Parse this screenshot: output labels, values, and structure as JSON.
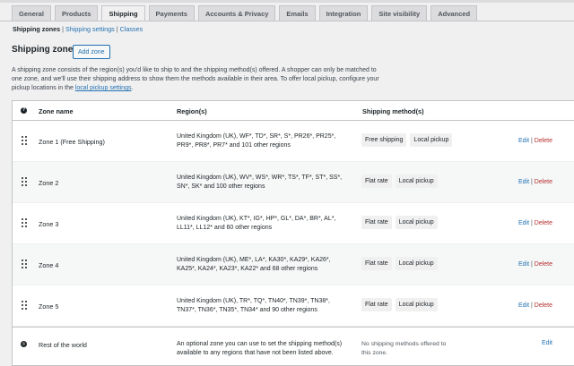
{
  "tabs": [
    "General",
    "Products",
    "Shipping",
    "Payments",
    "Accounts & Privacy",
    "Emails",
    "Integration",
    "Site visibility",
    "Advanced"
  ],
  "active_tab": 2,
  "subnav": {
    "current": "Shipping zones",
    "sep": "|",
    "links": [
      "Shipping settings",
      "Classes"
    ]
  },
  "page": {
    "title": "Shipping zones",
    "add_label": "Add zone"
  },
  "description": {
    "text": "A shipping zone consists of the region(s) you'd like to ship to and the shipping method(s) offered. A shopper can only be matched to one zone, and we'll use their shipping address to show them the methods available in their area. To offer local pickup, configure your pickup locations in the ",
    "link": "local pickup settings",
    "end": "."
  },
  "table": {
    "headers": {
      "help": "?",
      "name": "Zone name",
      "regions": "Region(s)",
      "methods": "Shipping method(s)"
    },
    "rows": [
      {
        "name": "Zone 1 (Free Shipping)",
        "regions_line1": "United Kingdom (UK), WF*, TD*, SR*, S*, PR26*, PR25*,",
        "regions_line2": "PR9*, PR8*, PR7* and 101 other regions",
        "methods": [
          "Free shipping",
          "Local pickup"
        ]
      },
      {
        "name": "Zone 2",
        "regions_line1": "United Kingdom (UK), WV*, WS*, WR*, TS*, TF*, ST*, SS*,",
        "regions_line2": "SN*, SK* and 100 other regions",
        "methods": [
          "Flat rate",
          "Local pickup"
        ]
      },
      {
        "name": "Zone 3",
        "regions_line1": "United Kingdom (UK), KT*, IG*, HP*, GL*, DA*, BR*, AL*,",
        "regions_line2": "LL11*, LL12* and 60 other regions",
        "methods": [
          "Flat rate",
          "Local pickup"
        ]
      },
      {
        "name": "Zone 4",
        "regions_line1": "United Kingdom (UK), ME*, LA*, KA30*, KA29*, KA26*,",
        "regions_line2": "KA25*, KA24*, KA23*, KA22* and 68 other regions",
        "methods": [
          "Flat rate",
          "Local pickup"
        ]
      },
      {
        "name": "Zone 5",
        "regions_line1": "United Kingdom (UK), TR*, TQ*, TN40*, TN39*, TN38*,",
        "regions_line2": "TN37*, TN36*, TN35*, TN34* and 90 other regions",
        "methods": [
          "Flat rate",
          "Local pickup"
        ]
      }
    ],
    "rest": {
      "name": "Rest of the world",
      "regions_line1": "An optional zone you can use to set the shipping method(s)",
      "regions_line2": "available to any regions that have not been listed above.",
      "methods_line1": "No shipping methods offered to",
      "methods_line2": "this zone.",
      "edit": "Edit"
    },
    "actions": {
      "edit": "Edit",
      "sep": "|",
      "delete": "Delete"
    }
  },
  "colors": {
    "link": "#2271b1",
    "delete": "#b32d2e",
    "background": "#f0f0f1"
  }
}
